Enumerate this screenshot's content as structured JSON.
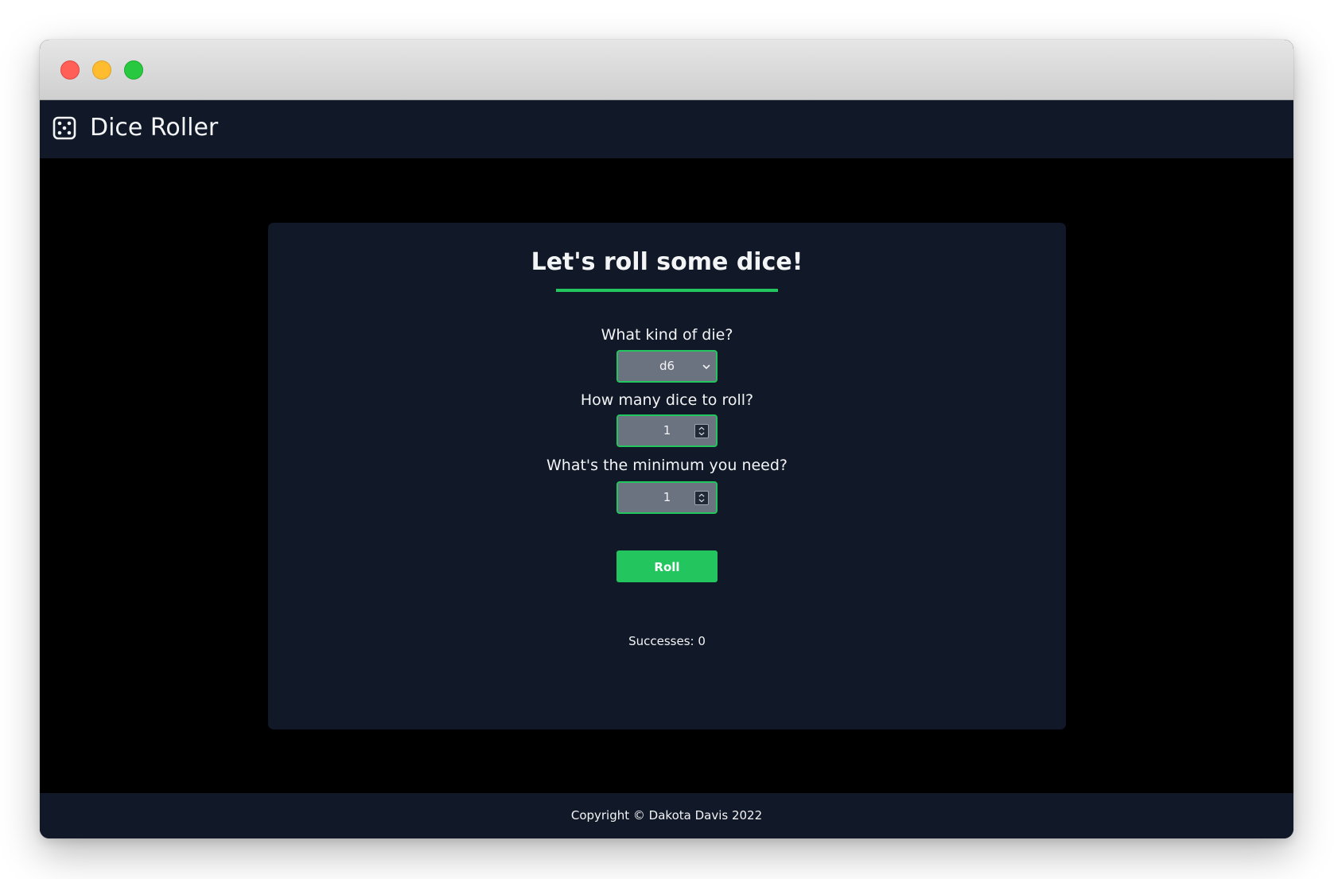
{
  "app": {
    "title": "Dice Roller",
    "icon": "dice-five-icon"
  },
  "window": {
    "controls": [
      "close",
      "minimize",
      "maximize"
    ],
    "colors": {
      "close": "#ff5f57",
      "minimize": "#febc2e",
      "maximize": "#28c840"
    }
  },
  "card": {
    "heading": "Let's roll some dice!",
    "die_label": "What kind of die?",
    "die_value": "d6",
    "count_label": "How many dice to roll?",
    "count_value": "1",
    "minimum_label": "What's the minimum you need?",
    "minimum_value": "1",
    "roll_label": "Roll",
    "successes_text": "Successes: 0"
  },
  "footer": {
    "text": "Copyright © Dakota Davis 2022"
  },
  "theme": {
    "accent": "#22c55e",
    "panel": "#111827",
    "background": "#000000",
    "field": "#6b7280"
  }
}
